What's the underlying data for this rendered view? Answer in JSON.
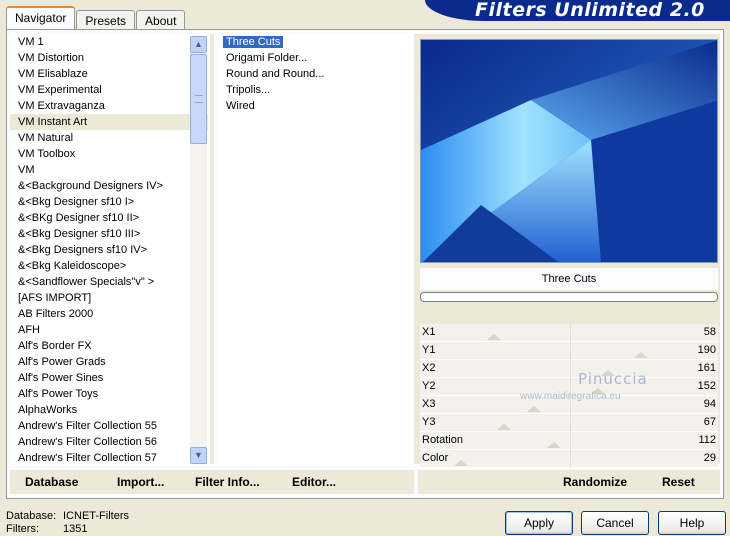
{
  "banner": {
    "title": "Filters Unlimited 2.0"
  },
  "tabs": [
    {
      "label": "Navigator",
      "active": true
    },
    {
      "label": "Presets",
      "active": false
    },
    {
      "label": "About",
      "active": false
    }
  ],
  "categories": [
    "VM 1",
    "VM Distortion",
    "VM Elisablaze",
    "VM Experimental",
    "VM Extravaganza",
    "VM Instant Art",
    "VM Natural",
    "VM Toolbox",
    "VM",
    "&<Background Designers IV>",
    "&<Bkg Designer sf10 I>",
    "&<BKg Designer sf10 II>",
    "&<Bkg Designer sf10 III>",
    "&<Bkg Designers sf10 IV>",
    "&<Bkg Kaleidoscope>",
    "&<Sandflower Specials\"v\" >",
    "[AFS IMPORT]",
    "AB Filters 2000",
    "AFH",
    "Alf's Border FX",
    "Alf's Power Grads",
    "Alf's Power Sines",
    "Alf's Power Toys",
    "AlphaWorks",
    "Andrew's Filter Collection 55",
    "Andrew's Filter Collection 56",
    "Andrew's Filter Collection 57"
  ],
  "selected_category_index": 5,
  "filters": [
    "Three Cuts",
    "Origami Folder...",
    "Round and Round...",
    "Tripolis...",
    "Wired"
  ],
  "selected_filter_index": 0,
  "current_filter_name": "Three Cuts",
  "params": [
    {
      "name": "X1",
      "value": "58"
    },
    {
      "name": "Y1",
      "value": "190"
    },
    {
      "name": "X2",
      "value": "161"
    },
    {
      "name": "Y2",
      "value": "152"
    },
    {
      "name": "X3",
      "value": "94"
    },
    {
      "name": "Y3",
      "value": "67"
    },
    {
      "name": "Rotation",
      "value": "112"
    },
    {
      "name": "Color",
      "value": "29"
    }
  ],
  "watermark": {
    "line1": "Pinuccia",
    "line2": "www.maidiregrafica.eu"
  },
  "toolbar": {
    "database": "Database",
    "import": "Import...",
    "filter_info": "Filter Info...",
    "editor": "Editor...",
    "randomize": "Randomize",
    "reset": "Reset"
  },
  "status": {
    "database_label": "Database:",
    "database_value": "ICNET-Filters",
    "filters_label": "Filters:",
    "filters_value": "1351"
  },
  "buttons": {
    "apply": "Apply",
    "cancel": "Cancel",
    "help": "Help"
  },
  "colors": {
    "banner": "#0a2a8c",
    "selection": "#316ac5",
    "preview_dark": "#0a2a8c",
    "preview_light": "#9fe3ff"
  }
}
